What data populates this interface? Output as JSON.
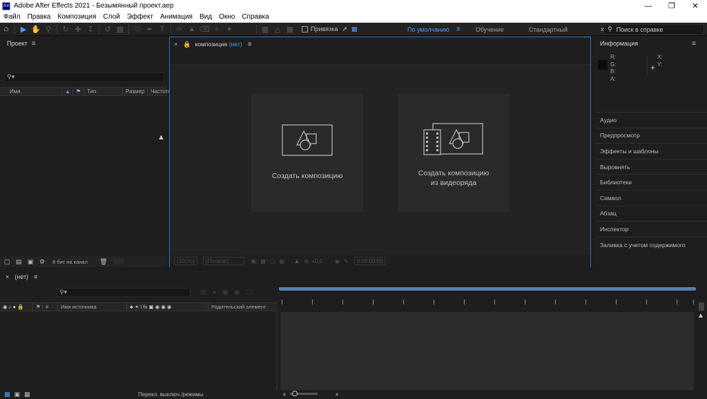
{
  "window": {
    "app_icon": "Ae",
    "title": "Adobe After Effects 2021 - Безымянный проект.aep",
    "controls": [
      "minimize-icon",
      "restore-icon",
      "close-icon"
    ]
  },
  "menu": [
    "Файл",
    "Правка",
    "Композиция",
    "Слой",
    "Эффект",
    "Анимация",
    "Вид",
    "Окно",
    "Справка"
  ],
  "toolbar": {
    "snapping_label": "Привязка",
    "workspaces": [
      "По умолчанию",
      "Обучение",
      "Стандартный"
    ],
    "active_workspace": "По умолчанию",
    "help_search_placeholder": "Поиск в справке",
    "tool_icons": [
      "home-icon",
      "selection-icon",
      "hand-icon",
      "zoom-icon",
      "rotate-icon",
      "anchor-icon",
      "move-icon",
      "undo-icon",
      "camera-icon",
      "rect-icon",
      "pen-icon",
      "text-icon",
      "brush-icon",
      "clone-icon",
      "eraser-icon",
      "roto-icon",
      "puppet-icon"
    ]
  },
  "project": {
    "title": "Проект",
    "search_placeholder": "",
    "columns": [
      "Имя",
      "Тип",
      "Размер",
      "Частота"
    ],
    "bit_depth": "8 бит на канал"
  },
  "composition": {
    "tab_label": "композиция",
    "tab_value": "(нет)",
    "card_new": "Создать композицию",
    "card_from_footage_line1": "Создать композицию",
    "card_from_footage_line2": "из видеоряда",
    "footer": {
      "zoom": "(100%)",
      "resolution": "(Полное)",
      "exposure": "+0,0",
      "timecode": "0:00:00:00"
    }
  },
  "info": {
    "title": "Информация",
    "channels": [
      "R:",
      "G:",
      "B:",
      "A:"
    ],
    "coords": [
      "X:",
      "Y:"
    ],
    "sections": [
      "Аудио",
      "Предпросмотр",
      "Эффекты и шаблоны",
      "Выровнять",
      "Библиотеки",
      "Символ",
      "Абзац",
      "Инспектор",
      "Заливка с учетом содержимого"
    ]
  },
  "timeline": {
    "tab_label": "(нет)",
    "columns": [
      "#",
      "Имя источника",
      "Родительский элемент"
    ],
    "switches_toggle": "Перекл. выключ./режимы"
  },
  "colors": {
    "accent": "#2d74c8",
    "accent_text": "#4b9cf5",
    "panel_bg": "#1e1e1e",
    "titlebar_bg": "#ffffff"
  }
}
